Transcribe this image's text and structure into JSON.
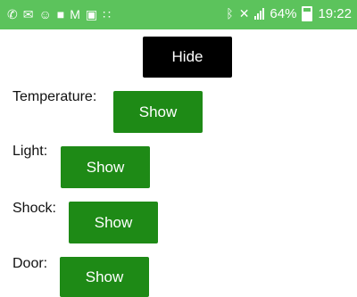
{
  "status_bar": {
    "battery_percent": "64%",
    "time": "19:22",
    "left_icons": [
      "phone-icon",
      "message-icon",
      "notification-icon",
      "bag-icon",
      "gmail-icon",
      "image-icon",
      "apps-icon"
    ],
    "right_icons": [
      "bluetooth-icon",
      "mute-icon",
      "signal-icon",
      "battery-icon"
    ],
    "color": "#5cc35c"
  },
  "hide_button": {
    "label": "Hide"
  },
  "sensors": [
    {
      "label": "Temperature:",
      "button_label": "Show"
    },
    {
      "label": "Light:",
      "button_label": "Show"
    },
    {
      "label": "Shock:",
      "button_label": "Show"
    },
    {
      "label": "Door:",
      "button_label": "Show"
    }
  ],
  "colors": {
    "show_button": "#1e8a16",
    "hide_button": "#000000"
  }
}
